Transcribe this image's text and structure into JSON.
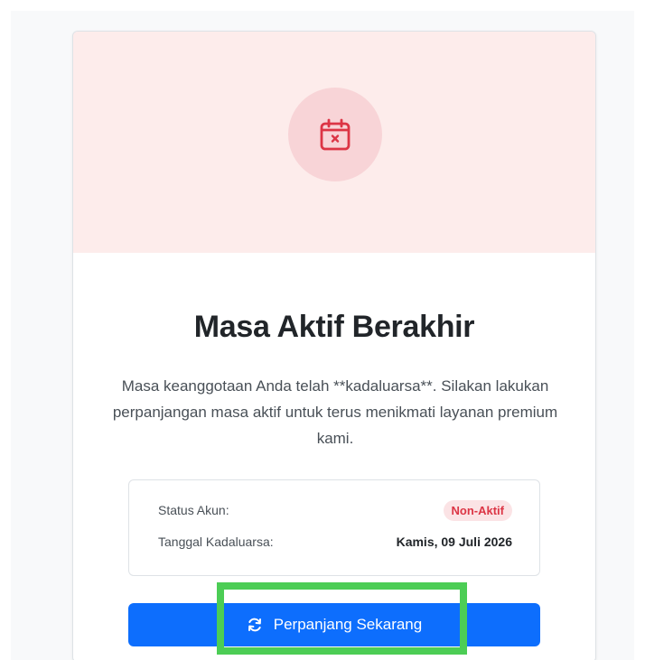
{
  "header": {
    "icon": "calendar-x-icon",
    "icon_color": "#dc3545"
  },
  "main": {
    "title": "Masa Aktif Berakhir",
    "description": "Masa keanggotaan Anda telah **kadaluarsa**. Silakan lakukan perpanjangan masa aktif untuk terus menikmati layanan premium kami."
  },
  "info": {
    "status_label": "Status Akun:",
    "status_value": "Non-Aktif",
    "expiry_label": "Tanggal Kadaluarsa:",
    "expiry_value": "Kamis, 09 Juli 2026"
  },
  "actions": {
    "renew_label": "Perpanjang Sekarang",
    "renew_icon": "refresh-icon"
  },
  "colors": {
    "primary": "#0d6efd",
    "danger": "#dc3545",
    "header_bg": "#fdeceb",
    "highlight": "#4ccd55"
  }
}
